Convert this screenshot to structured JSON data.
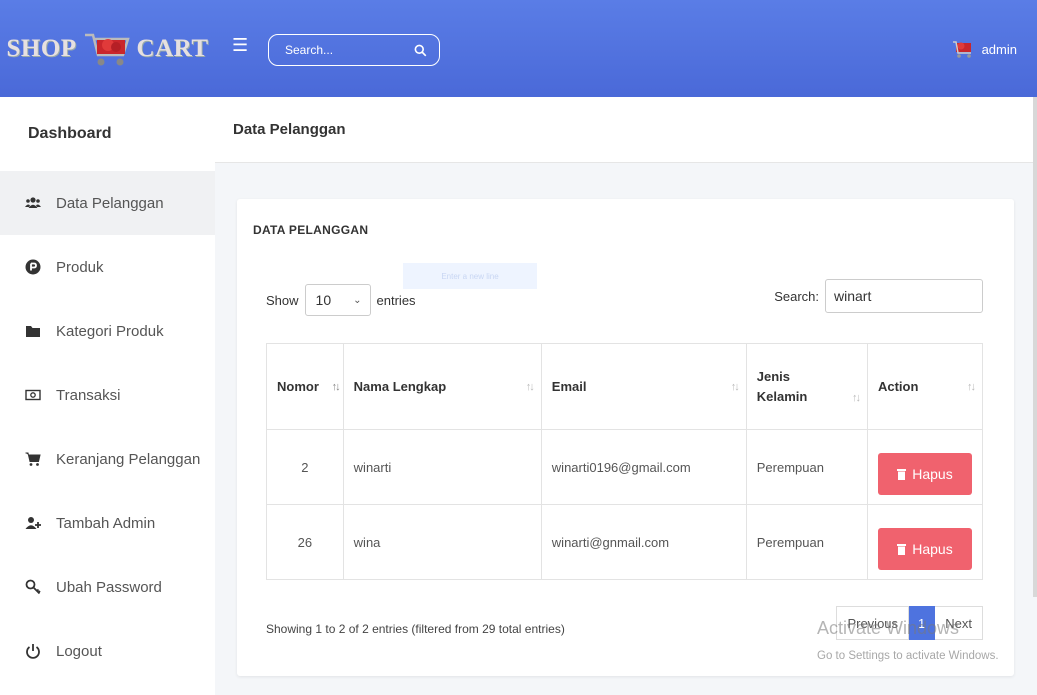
{
  "brand": {
    "part1": "SHOP",
    "part2": "CART"
  },
  "topbar": {
    "search_placeholder": "Search...",
    "user_name": "admin"
  },
  "sidebar": {
    "title": "Dashboard",
    "items": [
      {
        "label": "Data Pelanggan",
        "icon": "users-icon",
        "active": true
      },
      {
        "label": "Produk",
        "icon": "product-p-icon"
      },
      {
        "label": "Kategori Produk",
        "icon": "folder-icon"
      },
      {
        "label": "Transaksi",
        "icon": "money-bill-icon"
      },
      {
        "label": "Keranjang Pelanggan",
        "icon": "cart-icon"
      },
      {
        "label": "Tambah Admin",
        "icon": "user-plus-icon"
      },
      {
        "label": "Ubah Password",
        "icon": "key-icon"
      },
      {
        "label": "Logout",
        "icon": "power-icon"
      }
    ]
  },
  "page": {
    "header": "Data Pelanggan"
  },
  "card": {
    "title": "DATA PELANGGAN",
    "faint_tip": "Enter a new line",
    "show_label": "Show",
    "entries_value": "10",
    "entries_label": "entries",
    "search_label": "Search:",
    "search_value": "winart"
  },
  "table": {
    "columns": [
      "Nomor",
      "Nama Lengkap",
      "Email",
      "Jenis Kelamin",
      "Action"
    ],
    "rows": [
      {
        "nomor": "2",
        "nama": "winarti",
        "email": "winarti0196@gmail.com",
        "jk": "Perempuan",
        "action": "Hapus"
      },
      {
        "nomor": "26",
        "nama": "wina",
        "email": "winarti@gnmail.com",
        "jk": "Perempuan",
        "action": "Hapus"
      }
    ]
  },
  "footer": {
    "info": "Showing 1 to 2 of 2 entries (filtered from 29 total entries)",
    "prev": "Previous",
    "page": "1",
    "next": "Next"
  },
  "watermark": {
    "title": "Activate Windows",
    "sub": "Go to Settings to activate Windows."
  },
  "colors": {
    "navbar": "#4e73df",
    "danger": "#f0626e",
    "page_active": "#4e73df"
  }
}
